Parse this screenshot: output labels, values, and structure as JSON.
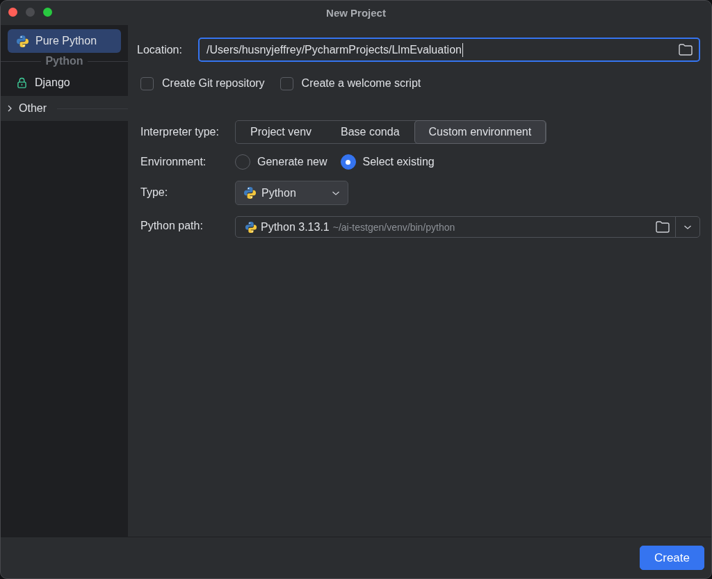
{
  "window": {
    "title": "New Project",
    "minimize_disabled": true
  },
  "sidebar": [
    {
      "kind": "item",
      "label": "Pure Python",
      "selected": true,
      "locked": false
    },
    {
      "kind": "header",
      "label": "Python"
    },
    {
      "kind": "item",
      "label": "Django",
      "selected": false,
      "locked": true
    },
    {
      "kind": "group",
      "label": "Other",
      "selected": false,
      "expanded": false
    }
  ],
  "location": {
    "label": "Location:",
    "value": "/Users/husnyjeffrey/PycharmProjects/LlmEvaluation",
    "focused": true
  },
  "options": [
    {
      "label": "Create Git repository",
      "checked": false
    },
    {
      "label": "Create a welcome script",
      "checked": false
    }
  ],
  "interpreter_type": {
    "label": "Interpreter type:",
    "options": [
      {
        "label": "Project venv",
        "selected": false
      },
      {
        "label": "Base conda",
        "selected": false
      },
      {
        "label": "Custom environment",
        "selected": true
      }
    ]
  },
  "environment": {
    "label": "Environment:",
    "options": [
      {
        "label": "Generate new",
        "selected": false
      },
      {
        "label": "Select existing",
        "selected": true
      }
    ]
  },
  "type": {
    "label": "Type:",
    "value": "Python"
  },
  "python_path": {
    "label": "Python path:",
    "value": "Python 3.13.1",
    "detail": "~/ai-testgen/venv/bin/python"
  },
  "buttons": [
    {
      "label": "Create",
      "kind": "primary"
    }
  ]
}
